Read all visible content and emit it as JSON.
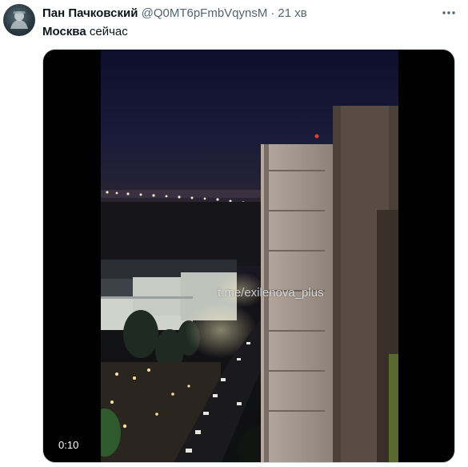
{
  "tweet": {
    "author_name": "Пан Пачковский",
    "handle": "@Q0MT6pFmbVqynsM",
    "separator": "·",
    "time": "21 хв",
    "more_icon": "more-icon",
    "text_bold": "Москва",
    "text_rest": " сейчас"
  },
  "media": {
    "watermark": "t.me/exilenova_plus",
    "duration": "0:10"
  },
  "colors": {
    "name": "#0f1419",
    "secondary": "#536471",
    "media_border": "#cfd9de"
  }
}
